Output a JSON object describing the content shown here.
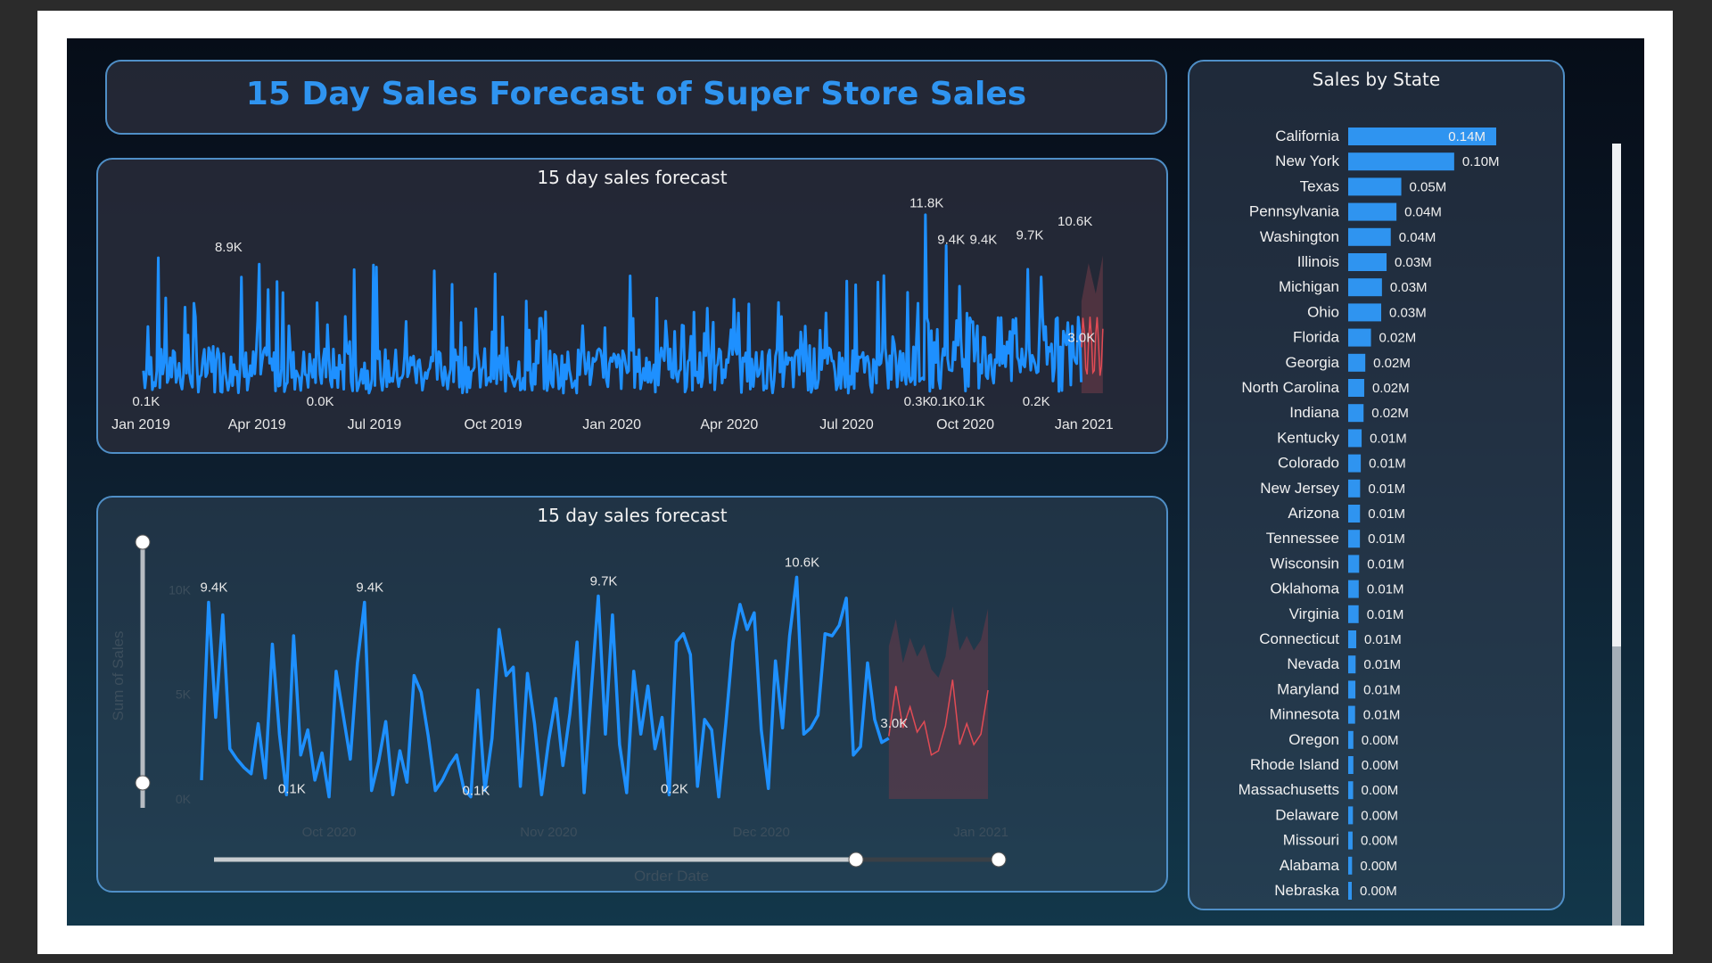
{
  "title": "15 Day Sales Forecast of Super Store Sales",
  "colors": {
    "accent": "#2f94f0",
    "actual": "#1e90ff",
    "forecast": "#e24b55",
    "band": "#6b3a48",
    "bar": "#2f94f0"
  },
  "chart_data": [
    {
      "type": "line",
      "title": "15 day sales forecast",
      "x_tick_labels": [
        "Jan 2019",
        "Apr 2019",
        "Jul 2019",
        "Oct 2019",
        "Jan 2020",
        "Apr 2020",
        "Jul 2020",
        "Oct 2020",
        "Jan 2021"
      ],
      "annotations": [
        {
          "x": "2019-03-10",
          "y": 8.9,
          "text": "8.9K"
        },
        {
          "x": "2019-01-05",
          "y": 0.1,
          "text": "0.1K"
        },
        {
          "x": "2019-05-20",
          "y": 0.0,
          "text": "0.0K"
        },
        {
          "x": "2020-09-01",
          "y": 11.8,
          "text": "11.8K"
        },
        {
          "x": "2020-09-20",
          "y": 9.4,
          "text": "9.4K"
        },
        {
          "x": "2020-10-15",
          "y": 9.4,
          "text": "9.4K"
        },
        {
          "x": "2020-11-20",
          "y": 9.7,
          "text": "9.7K"
        },
        {
          "x": "2020-12-25",
          "y": 10.6,
          "text": "10.6K"
        },
        {
          "x": "2020-12-30",
          "y": 3.0,
          "text": "3.0K"
        },
        {
          "x": "2020-08-25",
          "y": 0.3,
          "text": "0.3K"
        },
        {
          "x": "2020-09-25",
          "y": 0.1,
          "text": "0.1K0.1K"
        },
        {
          "x": "2020-11-25",
          "y": 0.2,
          "text": "0.2K"
        }
      ],
      "y_range_k": [
        0,
        12
      ]
    },
    {
      "type": "line",
      "title": "15 day sales forecast",
      "xlabel": "Order Date",
      "ylabel": "Sum of Sales",
      "y_ticks": [
        "10K",
        "5K",
        "0K"
      ],
      "x_tick_labels": [
        "Oct 2020",
        "Nov 2020",
        "Dec 2020",
        "Jan 2021"
      ],
      "ylim_k": [
        0,
        11
      ],
      "actual": {
        "start_date": "2020-09-12",
        "values_k": [
          0.9,
          9.4,
          3.9,
          8.8,
          2.4,
          1.9,
          1.5,
          1.2,
          3.6,
          1.0,
          7.4,
          3.1,
          0.2,
          7.8,
          2.1,
          3.3,
          0.9,
          2.2,
          0.1,
          6.1,
          4.0,
          1.9,
          6.5,
          9.4,
          0.4,
          1.8,
          3.7,
          0.2,
          2.3,
          0.8,
          5.9,
          5.1,
          3.0,
          0.4,
          0.9,
          1.6,
          2.1,
          0.5,
          0.1,
          5.2,
          0.4,
          2.9,
          8.1,
          5.9,
          6.3,
          0.6,
          6.0,
          3.6,
          0.2,
          2.8,
          4.8,
          1.6,
          4.1,
          7.5,
          0.3,
          5.1,
          9.7,
          3.1,
          8.8,
          2.6,
          0.3,
          6.1,
          3.1,
          5.4,
          2.4,
          3.9,
          0.2,
          7.5,
          7.9,
          6.9,
          0.6,
          3.8,
          3.3,
          0.1,
          3.6,
          7.5,
          9.3,
          8.1,
          8.9,
          3.3,
          0.5,
          6.6,
          3.4,
          7.8,
          10.6,
          3.1,
          3.4,
          4.0,
          7.9,
          7.8,
          8.3,
          9.6,
          2.1,
          2.5,
          6.5,
          3.8,
          2.7,
          2.9
        ]
      },
      "forecast": {
        "values_k": [
          3.0,
          5.4,
          3.4,
          4.4,
          3.2,
          3.7,
          2.1,
          2.3,
          3.5,
          5.7,
          2.6,
          3.6,
          2.6,
          3.1,
          5.2
        ],
        "upper_k": [
          7.3,
          8.6,
          6.5,
          7.7,
          6.8,
          7.4,
          6.2,
          5.8,
          6.8,
          9.2,
          7.1,
          7.8,
          7.1,
          7.6,
          9.1
        ],
        "lower_k": [
          0,
          0,
          0,
          0,
          0,
          0,
          0,
          0,
          0,
          0,
          0,
          0,
          0,
          0,
          0
        ]
      },
      "annotations": [
        {
          "index": 1,
          "text": "9.4K"
        },
        {
          "index": 12,
          "text": "0.1K"
        },
        {
          "index": 23,
          "text": "9.4K"
        },
        {
          "index": 38,
          "text": "0.1K"
        },
        {
          "index": 56,
          "text": "9.7K"
        },
        {
          "index": 66,
          "text": "0.2K"
        },
        {
          "index": 84,
          "text": "10.6K"
        },
        {
          "index": 97,
          "text": "3.0K"
        }
      ]
    },
    {
      "type": "bar",
      "orientation": "horizontal",
      "title": "Sales by State",
      "categories": [
        "California",
        "New York",
        "Texas",
        "Pennsylvania",
        "Washington",
        "Illinois",
        "Michigan",
        "Ohio",
        "Florida",
        "Georgia",
        "North Carolina",
        "Indiana",
        "Kentucky",
        "Colorado",
        "New Jersey",
        "Arizona",
        "Tennessee",
        "Wisconsin",
        "Oklahoma",
        "Virginia",
        "Connecticut",
        "Nevada",
        "Maryland",
        "Minnesota",
        "Oregon",
        "Rhode Island",
        "Massachusetts",
        "Delaware",
        "Missouri",
        "Alabama",
        "Nebraska"
      ],
      "values_m": [
        0.1377,
        0.0986,
        0.0494,
        0.0449,
        0.0396,
        0.0357,
        0.0314,
        0.0307,
        0.0212,
        0.0159,
        0.0149,
        0.0143,
        0.0125,
        0.0117,
        0.0111,
        0.011,
        0.0109,
        0.0102,
        0.0098,
        0.0097,
        0.0075,
        0.0069,
        0.0067,
        0.0064,
        0.0048,
        0.0048,
        0.0046,
        0.0044,
        0.0041,
        0.0036,
        0.003
      ],
      "value_labels": [
        "0.14M",
        "0.10M",
        "0.05M",
        "0.04M",
        "0.04M",
        "0.03M",
        "0.03M",
        "0.03M",
        "0.02M",
        "0.02M",
        "0.02M",
        "0.02M",
        "0.01M",
        "0.01M",
        "0.01M",
        "0.01M",
        "0.01M",
        "0.01M",
        "0.01M",
        "0.01M",
        "0.01M",
        "0.01M",
        "0.01M",
        "0.01M",
        "0.00M",
        "0.00M",
        "0.00M",
        "0.00M",
        "0.00M",
        "0.00M",
        "0.00M"
      ]
    }
  ]
}
